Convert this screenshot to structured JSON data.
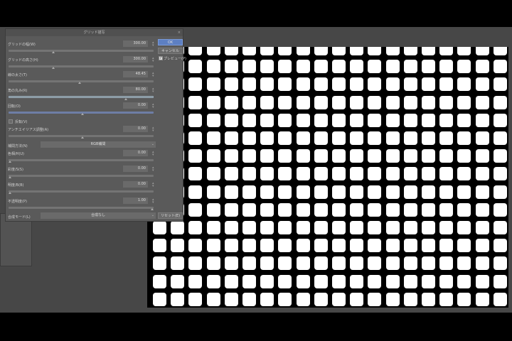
{
  "dialog": {
    "title": "グリッド描写",
    "close": "×",
    "fields": [
      {
        "label": "グリッドの幅(W)",
        "value": "300.00",
        "pos": 0.3
      },
      {
        "label": "グリッドの高さ(H)",
        "value": "300.00",
        "pos": 0.3
      },
      {
        "label": "線の太さ(T)",
        "value": "48.45",
        "pos": 0.48
      },
      {
        "label": "角の丸み(R)",
        "value": "80.00",
        "pos": 0.8
      },
      {
        "label": "回転(O)",
        "value": "0.00",
        "pos": 0.5
      }
    ],
    "flip_label": "反転(V)",
    "flip_checked": false,
    "antialias": {
      "label": "アンチエイリアス調整(A)",
      "value": "0.00",
      "pos": 0.5
    },
    "interp": {
      "label": "補間方法(N)",
      "value": "RGB補間"
    },
    "color_fields": [
      {
        "label": "色相/H(U)",
        "value": "0.00",
        "pos": 0
      },
      {
        "label": "彩度/S(S)",
        "value": "0.00",
        "pos": 0
      },
      {
        "label": "明度/B(B)",
        "value": "0.00",
        "pos": 0
      },
      {
        "label": "不透明度(P)",
        "value": "1.00",
        "pos": 1
      }
    ],
    "blend": {
      "label": "合成モード(L)",
      "value": "合成なし"
    },
    "buttons": {
      "ok": "OK",
      "cancel": "キャンセル",
      "preview": "プレビュー(P)",
      "preview_checked": true,
      "reset": "リセット(E)"
    }
  }
}
